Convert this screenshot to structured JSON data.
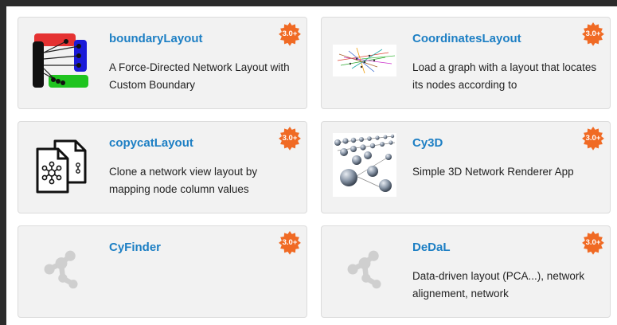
{
  "apps": [
    {
      "title": "boundaryLayout",
      "description": "A Force-Directed Network Layout with Custom Boundary",
      "badge": "3.0+",
      "thumb_icon": "boundary-layout-icon"
    },
    {
      "title": "CoordinatesLayout",
      "description": "Load a graph with a layout that locates its nodes according to",
      "badge": "3.0+",
      "thumb_icon": "coordinates-layout-graph-icon"
    },
    {
      "title": "copycatLayout",
      "description": "Clone a network view layout by mapping node column values",
      "badge": "3.0+",
      "thumb_icon": "copy-documents-network-icon"
    },
    {
      "title": "Cy3D",
      "description": "Simple 3D Network Renderer App",
      "badge": "3.0+",
      "thumb_icon": "3d-spheres-icon"
    },
    {
      "title": "CyFinder",
      "description": "",
      "badge": "3.0+",
      "thumb_icon": "network-placeholder-icon"
    },
    {
      "title": "DeDaL",
      "description": "Data-driven layout (PCA...), network alignement, network",
      "badge": "3.0+",
      "thumb_icon": "network-placeholder-icon"
    }
  ],
  "colors": {
    "badge": "#f06a24",
    "title": "#1d7fc4",
    "card_bg": "#f2f2f2",
    "background": "#2b2b2b"
  }
}
